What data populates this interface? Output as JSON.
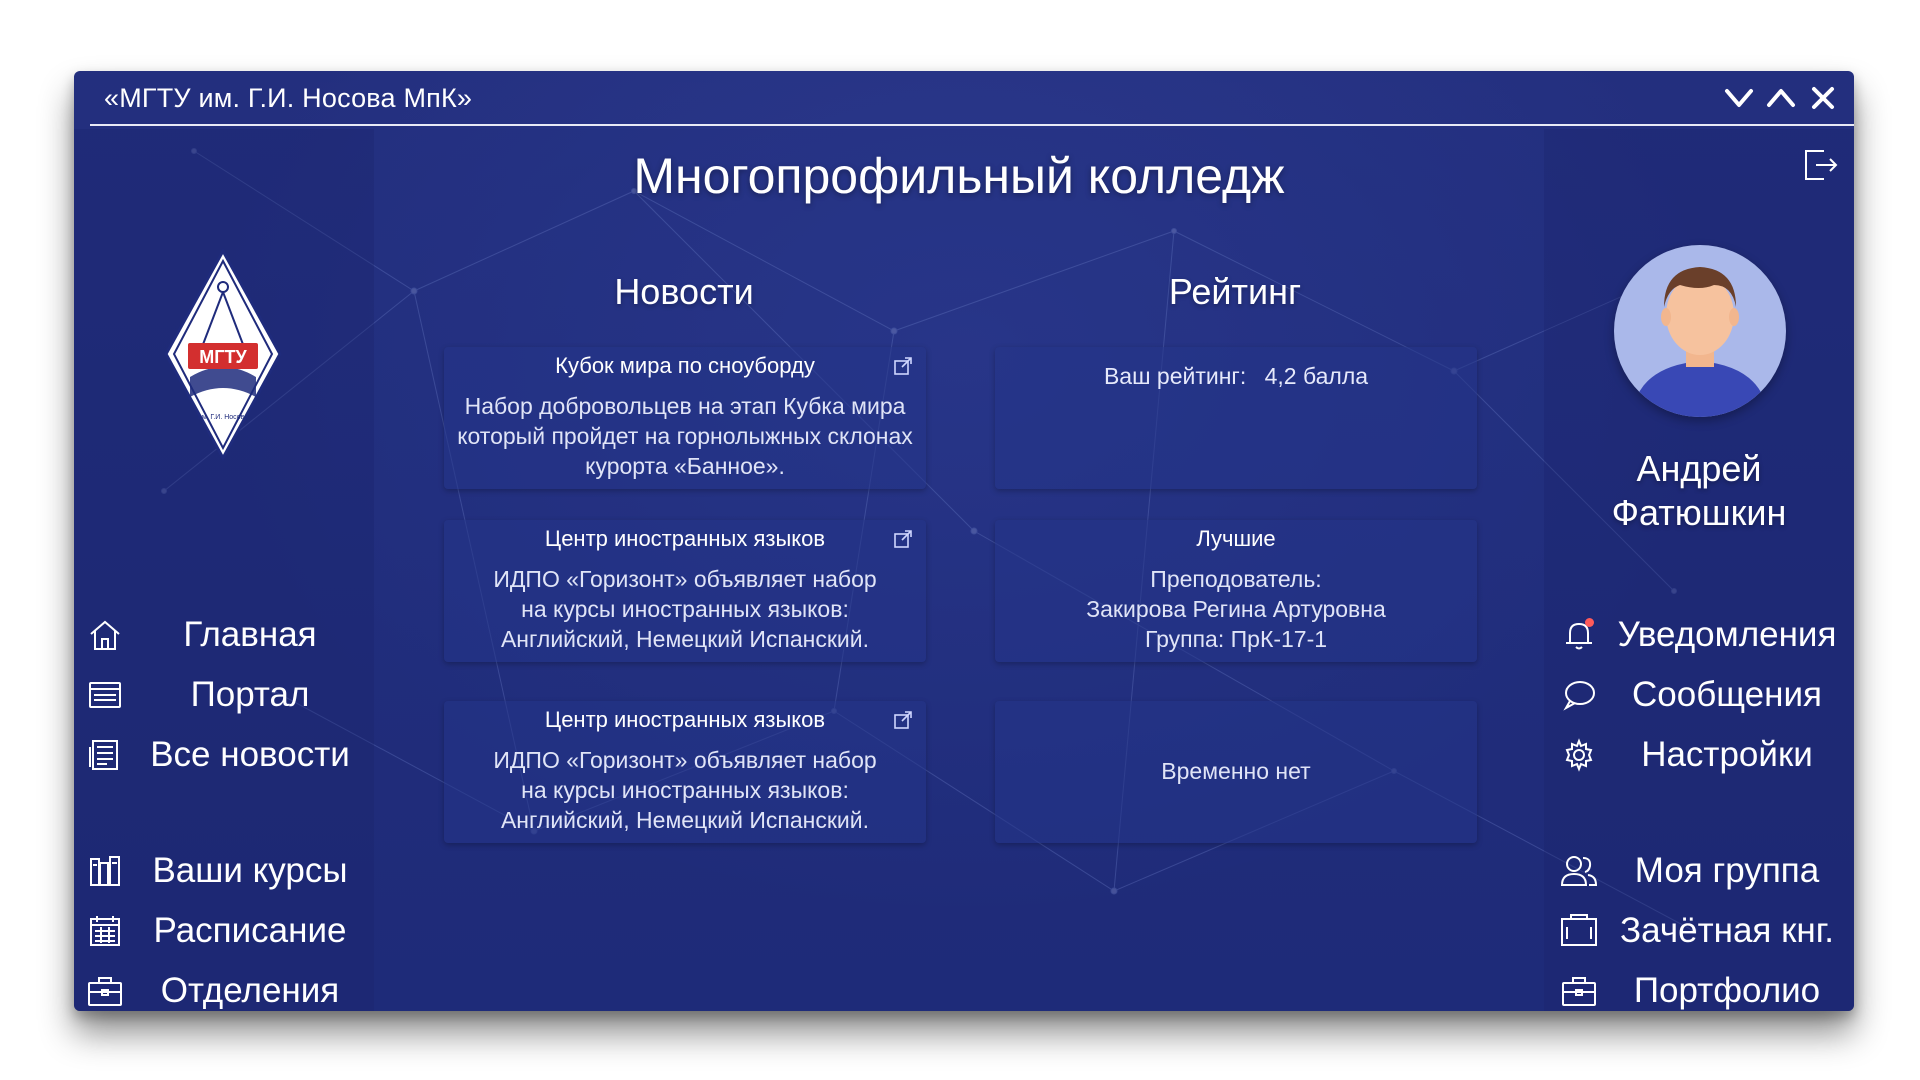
{
  "window": {
    "title": "«МГТУ им. Г.И. Носова МпК»"
  },
  "logo": {
    "text": "МГТУ",
    "subtext": "им. Г.И. Носова"
  },
  "main": {
    "title": "Многопрофильный колледж",
    "news": {
      "heading": "Новости",
      "items": [
        {
          "title": "Кубок мира по сноуборду",
          "lines": [
            "Набор добровольцев на этап Кубка мира",
            "который пройдет на горнолыжных склонах",
            "курорта «Банное»."
          ]
        },
        {
          "title": "Центр иностранных языков",
          "lines": [
            "ИДПО «Горизонт»  объявляет набор",
            "на курсы иностранных языков:",
            "Английский, Немецкий Испанский."
          ]
        },
        {
          "title": "Центр иностранных языков",
          "lines": [
            "ИДПО «Горизонт»  объявляет набор",
            "на курсы иностранных языков:",
            "Английский, Немецкий Испанский."
          ]
        }
      ]
    },
    "rating": {
      "heading": "Рейтинг",
      "your_label": "Ваш рейтинг:",
      "your_value": "4,2 балла",
      "best": {
        "title": "Лучшие",
        "lines": [
          "Преподователь:",
          "Закирова Регина Артуровна",
          "Группа: ПрК-17-1"
        ]
      },
      "empty": "Временно нет"
    }
  },
  "left_nav": [
    {
      "label": "Главная",
      "icon": "home-icon"
    },
    {
      "label": "Портал",
      "icon": "browser-window-icon"
    },
    {
      "label": "Все новости",
      "icon": "newspaper-icon"
    },
    {
      "label": "Ваши курсы",
      "icon": "books-icon"
    },
    {
      "label": "Расписание",
      "icon": "calendar-icon"
    },
    {
      "label": "Отделения",
      "icon": "briefcase-icon"
    }
  ],
  "user": {
    "name_line1": "Андрей",
    "name_line2": "Фатюшкин"
  },
  "right_nav": [
    {
      "label": "Уведомления",
      "icon": "bell-icon",
      "has_badge": true
    },
    {
      "label": "Сообщения",
      "icon": "chat-bubble-icon"
    },
    {
      "label": "Настройки",
      "icon": "gear-icon"
    },
    {
      "label": "Моя группа",
      "icon": "group-icon"
    },
    {
      "label": "Зачётная кнг.",
      "icon": "record-book-icon"
    },
    {
      "label": "Портфолио",
      "icon": "portfolio-icon"
    }
  ],
  "colors": {
    "background": "#1f2b7c",
    "accent_red": "#d32f2f",
    "badge": "#ff5a5a"
  }
}
